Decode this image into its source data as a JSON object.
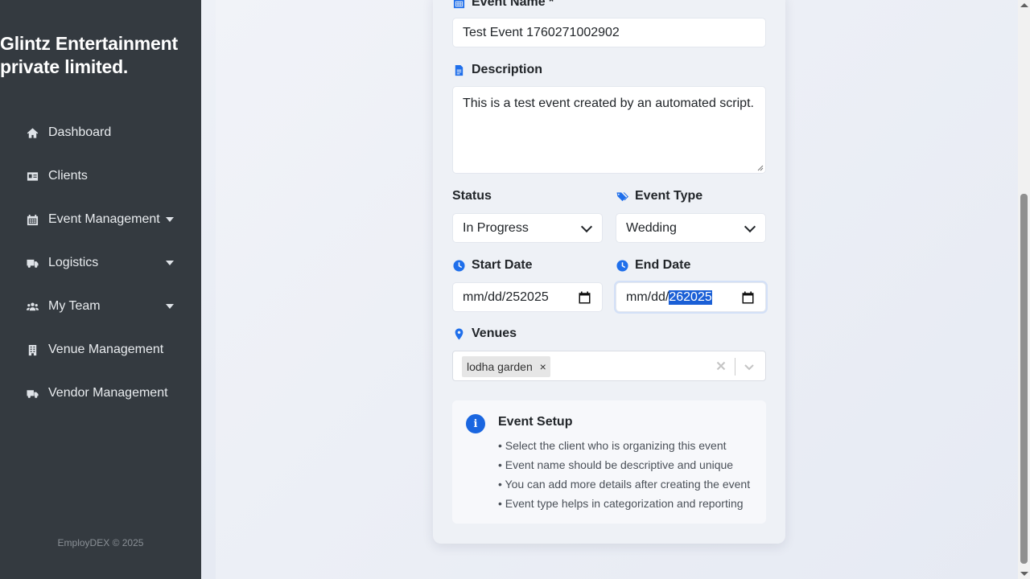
{
  "sidebar": {
    "company_line1": "Glintz Entertainment",
    "company_line2": "private limited.",
    "items": [
      {
        "label": "Dashboard",
        "icon": "home-icon"
      },
      {
        "label": "Clients",
        "icon": "id-card-icon"
      },
      {
        "label": "Event Management",
        "icon": "calendar-icon",
        "has_caret": true
      },
      {
        "label": "Logistics",
        "icon": "truck-icon",
        "has_caret": true
      },
      {
        "label": "My Team",
        "icon": "users-icon",
        "has_caret": true
      },
      {
        "label": "Venue Management",
        "icon": "building-icon"
      },
      {
        "label": "Vendor Management",
        "icon": "shipping-icon"
      }
    ],
    "footer": "EmployDEX © 2025"
  },
  "form": {
    "event_name_label": "Event Name *",
    "event_name_value": "Test Event 1760271002902",
    "description_label": "Description",
    "description_value": "This is a test event created by an automated script.",
    "status_label": "Status",
    "status_value": "In Progress",
    "event_type_label": "Event Type",
    "event_type_value": "Wedding",
    "start_date_label": "Start Date",
    "start_date_value": "mm/dd/252025",
    "end_date_label": "End Date",
    "end_date_prefix": "mm/dd/",
    "end_date_selected": "262025",
    "venues_label": "Venues",
    "venue_chip": "lodha garden",
    "venue_chip_remove": "×"
  },
  "info": {
    "icon_text": "i",
    "title": "Event Setup",
    "bullets": [
      "• Select the client who is organizing this event",
      "• Event name should be descriptive and unique",
      "• You can add more details after creating the event",
      "• Event type helps in categorization and reporting"
    ]
  },
  "colors": {
    "sidebar_bg": "#343a40",
    "accent": "#1a66e0",
    "selection": "#1a5fd6"
  }
}
